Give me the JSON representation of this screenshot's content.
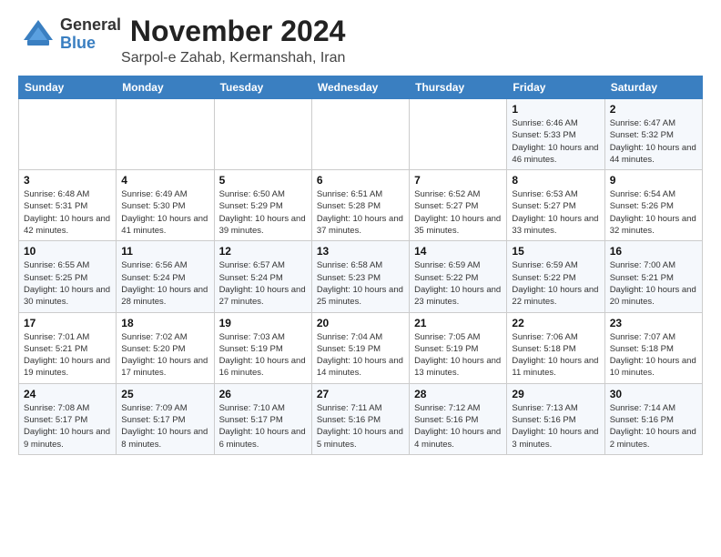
{
  "header": {
    "logo_general": "General",
    "logo_blue": "Blue",
    "month_title": "November 2024",
    "location": "Sarpol-e Zahab, Kermanshah, Iran"
  },
  "weekdays": [
    "Sunday",
    "Monday",
    "Tuesday",
    "Wednesday",
    "Thursday",
    "Friday",
    "Saturday"
  ],
  "weeks": [
    [
      {
        "day": "",
        "info": ""
      },
      {
        "day": "",
        "info": ""
      },
      {
        "day": "",
        "info": ""
      },
      {
        "day": "",
        "info": ""
      },
      {
        "day": "",
        "info": ""
      },
      {
        "day": "1",
        "info": "Sunrise: 6:46 AM\nSunset: 5:33 PM\nDaylight: 10 hours and 46 minutes."
      },
      {
        "day": "2",
        "info": "Sunrise: 6:47 AM\nSunset: 5:32 PM\nDaylight: 10 hours and 44 minutes."
      }
    ],
    [
      {
        "day": "3",
        "info": "Sunrise: 6:48 AM\nSunset: 5:31 PM\nDaylight: 10 hours and 42 minutes."
      },
      {
        "day": "4",
        "info": "Sunrise: 6:49 AM\nSunset: 5:30 PM\nDaylight: 10 hours and 41 minutes."
      },
      {
        "day": "5",
        "info": "Sunrise: 6:50 AM\nSunset: 5:29 PM\nDaylight: 10 hours and 39 minutes."
      },
      {
        "day": "6",
        "info": "Sunrise: 6:51 AM\nSunset: 5:28 PM\nDaylight: 10 hours and 37 minutes."
      },
      {
        "day": "7",
        "info": "Sunrise: 6:52 AM\nSunset: 5:27 PM\nDaylight: 10 hours and 35 minutes."
      },
      {
        "day": "8",
        "info": "Sunrise: 6:53 AM\nSunset: 5:27 PM\nDaylight: 10 hours and 33 minutes."
      },
      {
        "day": "9",
        "info": "Sunrise: 6:54 AM\nSunset: 5:26 PM\nDaylight: 10 hours and 32 minutes."
      }
    ],
    [
      {
        "day": "10",
        "info": "Sunrise: 6:55 AM\nSunset: 5:25 PM\nDaylight: 10 hours and 30 minutes."
      },
      {
        "day": "11",
        "info": "Sunrise: 6:56 AM\nSunset: 5:24 PM\nDaylight: 10 hours and 28 minutes."
      },
      {
        "day": "12",
        "info": "Sunrise: 6:57 AM\nSunset: 5:24 PM\nDaylight: 10 hours and 27 minutes."
      },
      {
        "day": "13",
        "info": "Sunrise: 6:58 AM\nSunset: 5:23 PM\nDaylight: 10 hours and 25 minutes."
      },
      {
        "day": "14",
        "info": "Sunrise: 6:59 AM\nSunset: 5:22 PM\nDaylight: 10 hours and 23 minutes."
      },
      {
        "day": "15",
        "info": "Sunrise: 6:59 AM\nSunset: 5:22 PM\nDaylight: 10 hours and 22 minutes."
      },
      {
        "day": "16",
        "info": "Sunrise: 7:00 AM\nSunset: 5:21 PM\nDaylight: 10 hours and 20 minutes."
      }
    ],
    [
      {
        "day": "17",
        "info": "Sunrise: 7:01 AM\nSunset: 5:21 PM\nDaylight: 10 hours and 19 minutes."
      },
      {
        "day": "18",
        "info": "Sunrise: 7:02 AM\nSunset: 5:20 PM\nDaylight: 10 hours and 17 minutes."
      },
      {
        "day": "19",
        "info": "Sunrise: 7:03 AM\nSunset: 5:19 PM\nDaylight: 10 hours and 16 minutes."
      },
      {
        "day": "20",
        "info": "Sunrise: 7:04 AM\nSunset: 5:19 PM\nDaylight: 10 hours and 14 minutes."
      },
      {
        "day": "21",
        "info": "Sunrise: 7:05 AM\nSunset: 5:19 PM\nDaylight: 10 hours and 13 minutes."
      },
      {
        "day": "22",
        "info": "Sunrise: 7:06 AM\nSunset: 5:18 PM\nDaylight: 10 hours and 11 minutes."
      },
      {
        "day": "23",
        "info": "Sunrise: 7:07 AM\nSunset: 5:18 PM\nDaylight: 10 hours and 10 minutes."
      }
    ],
    [
      {
        "day": "24",
        "info": "Sunrise: 7:08 AM\nSunset: 5:17 PM\nDaylight: 10 hours and 9 minutes."
      },
      {
        "day": "25",
        "info": "Sunrise: 7:09 AM\nSunset: 5:17 PM\nDaylight: 10 hours and 8 minutes."
      },
      {
        "day": "26",
        "info": "Sunrise: 7:10 AM\nSunset: 5:17 PM\nDaylight: 10 hours and 6 minutes."
      },
      {
        "day": "27",
        "info": "Sunrise: 7:11 AM\nSunset: 5:16 PM\nDaylight: 10 hours and 5 minutes."
      },
      {
        "day": "28",
        "info": "Sunrise: 7:12 AM\nSunset: 5:16 PM\nDaylight: 10 hours and 4 minutes."
      },
      {
        "day": "29",
        "info": "Sunrise: 7:13 AM\nSunset: 5:16 PM\nDaylight: 10 hours and 3 minutes."
      },
      {
        "day": "30",
        "info": "Sunrise: 7:14 AM\nSunset: 5:16 PM\nDaylight: 10 hours and 2 minutes."
      }
    ]
  ]
}
